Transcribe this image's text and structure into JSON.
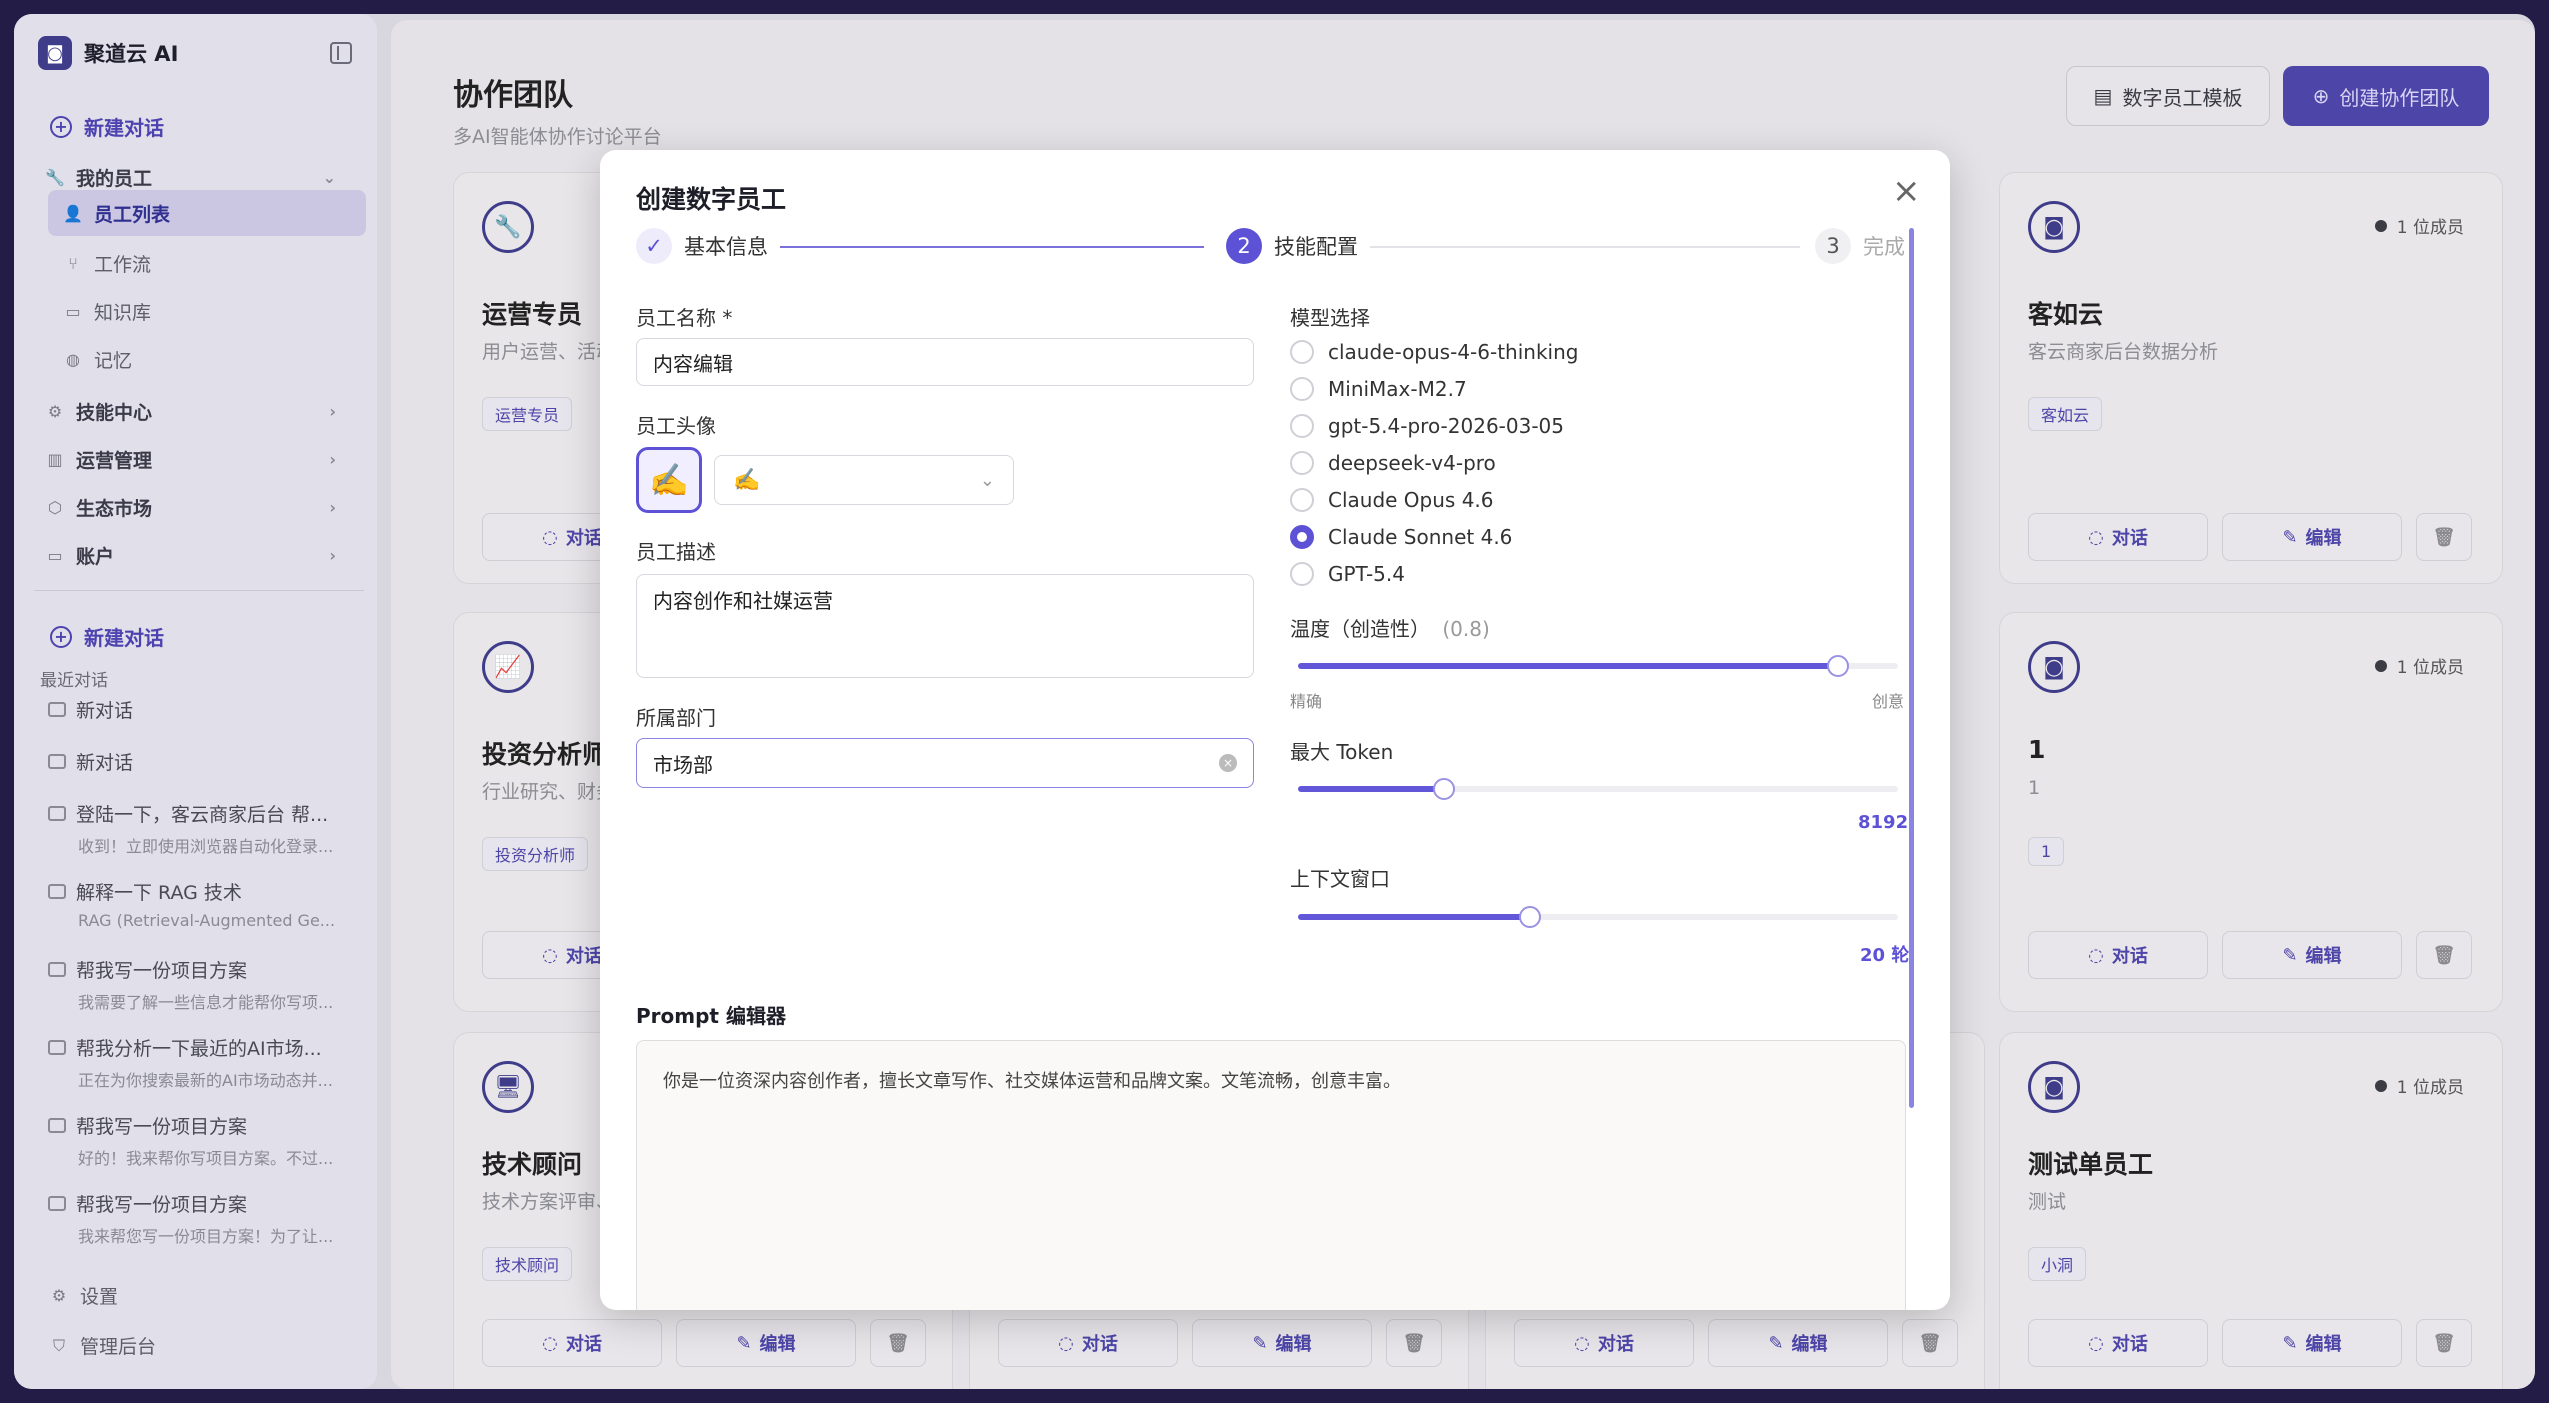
{
  "sidebar": {
    "brand": "聚道云 AI",
    "new_chat": "新建对话",
    "my_staff": "我的员工",
    "staff_list": "员工列表",
    "workflow": "工作流",
    "knowledge": "知识库",
    "memory": "记忆",
    "skills": "技能中心",
    "ops": "运营管理",
    "market": "生态市场",
    "account": "账户",
    "new_chat2": "新建对话",
    "recent": "最近对话",
    "chats": [
      {
        "title": "新对话",
        "preview": ""
      },
      {
        "title": "新对话",
        "preview": ""
      },
      {
        "title": "登陆一下，客云商家后台 帮...",
        "preview": "收到！立即使用浏览器自动化登录..."
      },
      {
        "title": "解释一下 RAG 技术",
        "preview": "RAG (Retrieval-Augmented Ge..."
      },
      {
        "title": "帮我写一份项目方案",
        "preview": "我需要了解一些信息才能帮你写项..."
      },
      {
        "title": "帮我分析一下最近的AI市场...",
        "preview": "正在为你搜索最新的AI市场动态并..."
      },
      {
        "title": "帮我写一份项目方案",
        "preview": "好的！我来帮你写项目方案。不过..."
      },
      {
        "title": "帮我写一份项目方案",
        "preview": "我来帮您写一份项目方案！为了让..."
      }
    ],
    "settings": "设置",
    "admin": "管理后台"
  },
  "header": {
    "title": "协作团队",
    "subtitle": "多AI智能体协作讨论平台",
    "template_btn": "数字员工模板",
    "create_btn": "创建协作团队"
  },
  "cards": {
    "c1": {
      "name": "运营专员",
      "desc": "用户运营、活动",
      "tag": "运营专员",
      "chat": "对话"
    },
    "c2": {
      "name": "投资分析师",
      "desc": "行业研究、财务",
      "tag": "投资分析师",
      "chat": "对话"
    },
    "c3": {
      "name": "技术顾问",
      "desc": "技术方案评审、",
      "tag": "技术顾问",
      "chat": "对话",
      "edit": "编辑"
    },
    "b2": {
      "chat": "对话",
      "edit": "编辑"
    },
    "b3": {
      "chat": "对话",
      "edit": "编辑"
    },
    "r1": {
      "name": "客如云",
      "desc": "客云商家后台数据分析",
      "tag": "客如云",
      "members": "1 位成员",
      "chat": "对话",
      "edit": "编辑"
    },
    "r2": {
      "name": "1",
      "desc": "1",
      "tag": "1",
      "members": "1 位成员",
      "chat": "对话",
      "edit": "编辑"
    },
    "r3": {
      "name": "测试单员工",
      "desc": "测试",
      "tag": "小洞",
      "members": "1 位成员",
      "chat": "对话",
      "edit": "编辑"
    }
  },
  "modal": {
    "title": "创建数字员工",
    "steps": [
      {
        "num": "✓",
        "label": "基本信息"
      },
      {
        "num": "2",
        "label": "技能配置"
      },
      {
        "num": "3",
        "label": "完成"
      }
    ],
    "name_label": "员工名称 *",
    "name_value": "内容编辑",
    "avatar_label": "员工头像",
    "avatar_emoji": "✍️",
    "desc_label": "员工描述",
    "desc_value": "内容创作和社媒运营",
    "dept_label": "所属部门",
    "dept_value": "市场部",
    "model_label": "模型选择",
    "models": [
      "claude-opus-4-6-thinking",
      "MiniMax-M2.7",
      "gpt-5.4-pro-2026-03-05",
      "deepseek-v4-pro",
      "Claude Opus 4.6",
      "Claude Sonnet 4.6",
      "GPT-5.4"
    ],
    "selected_model": "Claude Sonnet 4.6",
    "temp_label": "温度（创造性）",
    "temp_value": "(0.8)",
    "temp_fraction": 0.8,
    "temp_min": "精确",
    "temp_max": "创意",
    "token_label": "最大 Token",
    "token_value": "8192",
    "ctx_label": "上下文窗口",
    "ctx_value": "20 轮",
    "prompt_label": "Prompt 编辑器",
    "prompt_value": "你是一位资深内容创作者，擅长文章写作、社交媒体运营和品牌文案。文笔流畅，创意丰富。"
  }
}
